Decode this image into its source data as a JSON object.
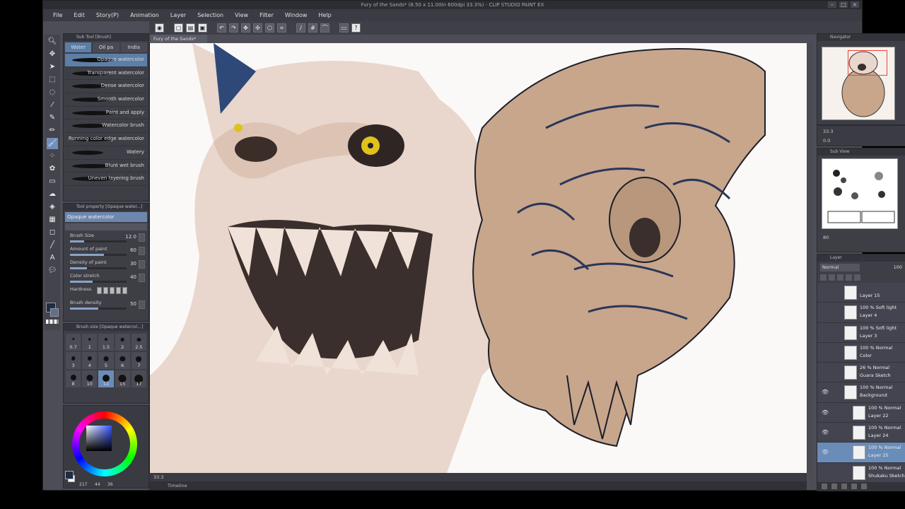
{
  "window": {
    "title": "Fury of the Sands* (8.50 x 11.00in 600dpi 33.3%) - CLIP STUDIO PAINT EX"
  },
  "menu": [
    "File",
    "Edit",
    "Story(P)",
    "Animation",
    "Layer",
    "Selection",
    "View",
    "Filter",
    "Window",
    "Help"
  ],
  "canvas": {
    "tab_label": "Fury of the Sands*",
    "status_zoom": "33.3",
    "timeline_label": "Timeline"
  },
  "subtool": {
    "header": "Sub Tool [Brush]",
    "tabs": [
      "Water",
      "Oil pa",
      "India"
    ],
    "brushes": [
      "Opaque watercolor",
      "Transparent watercolor",
      "Dense watercolor",
      "Smooth watercolor",
      "Paint and apply",
      "Watercolor brush",
      "Running color edge watercolor",
      "Watery",
      "Blunt wet brush",
      "Uneven layering brush"
    ]
  },
  "tool_property": {
    "header": "Tool property [Opaque water...]",
    "name": "Opaque watercolor",
    "props": [
      {
        "label": "Brush Size",
        "value": "12.0",
        "level": 0.25
      },
      {
        "label": "Amount of paint",
        "value": "60",
        "level": 0.6
      },
      {
        "label": "Density of paint",
        "value": "30",
        "level": 0.3
      },
      {
        "label": "Color stretch",
        "value": "40",
        "level": 0.4
      },
      {
        "label": "Hardness",
        "value": "",
        "level": 0
      },
      {
        "label": "Brush density",
        "value": "50",
        "level": 0.5
      }
    ]
  },
  "brush_size": {
    "header": "Brush size [Opaque watercol...]",
    "sizes": [
      "0.7",
      "1",
      "1.5",
      "2",
      "2.5",
      "3",
      "4",
      "5",
      "6",
      "7",
      "8",
      "10",
      "12",
      "15",
      "17"
    ],
    "active": "12"
  },
  "color": {
    "fg": "#1e2d45",
    "hsv_h": "217",
    "hsv_s": "44",
    "hsv_v": "36"
  },
  "navigator": {
    "header": "Navigator",
    "zoom": "33.3",
    "angle": "0.0"
  },
  "subview": {
    "header": "Sub View",
    "zoom": "80"
  },
  "layers": {
    "header": "Layer",
    "blend_mode": "Normal",
    "opacity": "100",
    "items": [
      {
        "mode": "",
        "name": "Layer 15",
        "selected": false,
        "indent": 0,
        "eye": false
      },
      {
        "mode": "100 % Soft light",
        "name": "Layer 4",
        "selected": false,
        "indent": 0,
        "eye": false
      },
      {
        "mode": "100 % Soft light",
        "name": "Layer 3",
        "selected": false,
        "indent": 0,
        "eye": false
      },
      {
        "mode": "100 % Normal",
        "name": "Color",
        "selected": false,
        "indent": 0,
        "eye": false
      },
      {
        "mode": "26 % Normal",
        "name": "Guara Sketch",
        "selected": false,
        "indent": 0,
        "eye": false
      },
      {
        "mode": "100 % Normal",
        "name": "Background",
        "selected": false,
        "indent": 0,
        "eye": true
      },
      {
        "mode": "100 % Normal",
        "name": "Layer 22",
        "selected": false,
        "indent": 1,
        "eye": true
      },
      {
        "mode": "100 % Normal",
        "name": "Layer 24",
        "selected": false,
        "indent": 1,
        "eye": true
      },
      {
        "mode": "100 % Normal",
        "name": "Layer 25",
        "selected": true,
        "indent": 1,
        "eye": true
      },
      {
        "mode": "100 % Normal",
        "name": "Shukaku Sketch",
        "selected": false,
        "indent": 1,
        "eye": false
      }
    ]
  }
}
